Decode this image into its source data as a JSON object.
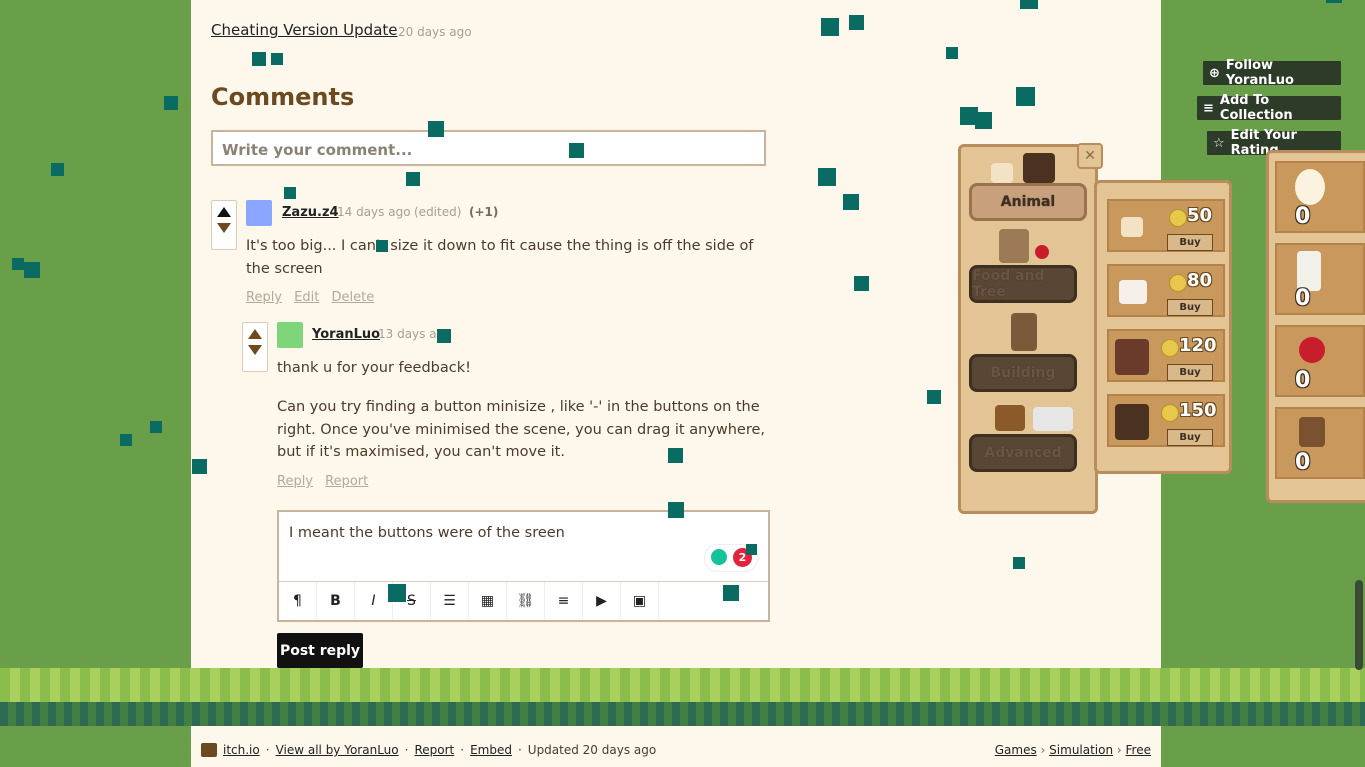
{
  "devlog": {
    "title": "Cheating Version Update",
    "time": "20 days ago"
  },
  "comments_heading": "Comments",
  "comment_input": {
    "placeholder": "Write your comment..."
  },
  "comments": [
    {
      "author": "Zazu.z4",
      "time": "14 days ago",
      "edited": "(edited)",
      "score": "(+1)",
      "body": "It's too big... I can't size it down to fit cause the thing is off the side of the screen",
      "actions": [
        "Reply",
        "Edit",
        "Delete"
      ]
    },
    {
      "author": "YoranLuo",
      "time": "13 days ago",
      "body_lines": [
        "thank u for your feedback!",
        "Can you try finding a button minisize , like '-' in the buttons on the right. Once you've minimised the scene, you can drag it anywhere, but if it's maximised, you can't move it."
      ],
      "actions": [
        "Reply",
        "Report"
      ]
    }
  ],
  "reply_editor": {
    "value": "I meant the buttons were of the sreen",
    "grammarly_count": "2",
    "toolbar": [
      "paragraph-icon",
      "bold-icon",
      "italic-icon",
      "strikethrough-icon",
      "bullet-list-icon",
      "table-icon",
      "link-icon",
      "align-icon",
      "video-icon",
      "image-icon"
    ]
  },
  "post_reply_label": "Post reply",
  "sidebar_buttons": {
    "follow": "Follow YoranLuo",
    "collection": "Add To Collection",
    "rating": "Edit Your Rating"
  },
  "game": {
    "categories": [
      "Animal",
      "Food and Tree",
      "Building",
      "Advanced"
    ],
    "shop_prices": [
      "50",
      "80",
      "120",
      "150"
    ],
    "buy_label": "Buy",
    "inventory_counts": [
      "0",
      "0",
      "0",
      "0"
    ]
  },
  "footer": {
    "site": "itch.io",
    "view_all": "View all by YoranLuo",
    "report": "Report",
    "embed": "Embed",
    "updated": "Updated 20 days ago",
    "crumbs": [
      "Games",
      "Simulation",
      "Free"
    ]
  },
  "colors": {
    "accent_teal": "#0a6b62",
    "page_bg": "#fdf7ec",
    "grass": "#6a9f4a"
  }
}
